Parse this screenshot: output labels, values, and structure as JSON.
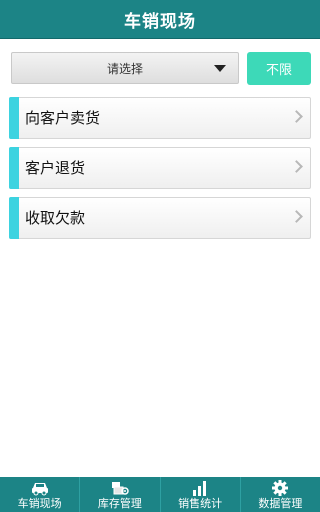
{
  "header": {
    "title": "车销现场"
  },
  "filter": {
    "select_label": "请选择",
    "unlimited_label": "不限"
  },
  "menu": {
    "items": [
      {
        "label": "向客户卖货"
      },
      {
        "label": "客户退货"
      },
      {
        "label": "收取欠款"
      }
    ]
  },
  "tabs": {
    "items": [
      {
        "label": "车销现场",
        "icon": "car-icon"
      },
      {
        "label": "库存管理",
        "icon": "inventory-icon"
      },
      {
        "label": "销售统计",
        "icon": "bar-chart-icon"
      },
      {
        "label": "数据管理",
        "icon": "gear-icon"
      }
    ]
  },
  "colors": {
    "primary": "#1c8486",
    "accent": "#3dd3e0",
    "button": "#3dd9b8"
  }
}
